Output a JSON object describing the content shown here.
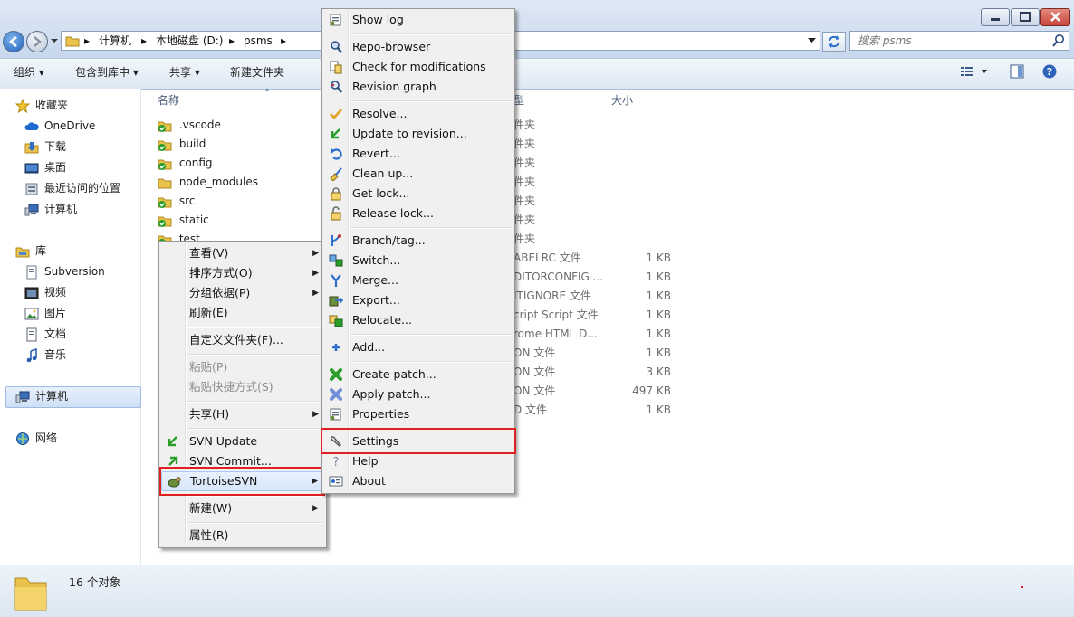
{
  "address": {
    "crumbs": [
      "计算机",
      "本地磁盘 (D:)",
      "psms"
    ]
  },
  "search": {
    "placeholder": "搜索 psms"
  },
  "toolbar": {
    "organize": "组织",
    "include": "包含到库中",
    "share": "共享",
    "new_folder": "新建文件夹"
  },
  "nav": {
    "favorites": "收藏夹",
    "fav_items": [
      "OneDrive",
      "下载",
      "桌面",
      "最近访问的位置",
      "计算机"
    ],
    "libraries": "库",
    "lib_items": [
      "Subversion",
      "视频",
      "图片",
      "文档",
      "音乐"
    ],
    "computer": "计算机",
    "network": "网络"
  },
  "columns": {
    "name": "名称",
    "type": "型",
    "size": "大小"
  },
  "files": [
    {
      "name": ".vscode",
      "type": "件夹",
      "size": ""
    },
    {
      "name": "build",
      "type": "件夹",
      "size": ""
    },
    {
      "name": "config",
      "type": "件夹",
      "size": ""
    },
    {
      "name": "node_modules",
      "type": "件夹",
      "size": ""
    },
    {
      "name": "src",
      "type": "件夹",
      "size": ""
    },
    {
      "name": "static",
      "type": "件夹",
      "size": ""
    },
    {
      "name": "test",
      "type": "件夹",
      "size": ""
    },
    {
      "name": "",
      "type": "ABELRC 文件",
      "size": "1 KB"
    },
    {
      "name": "",
      "type": "DITORCONFIG ...",
      "size": "1 KB"
    },
    {
      "name": "",
      "type": "ITIGNORE 文件",
      "size": "1 KB"
    },
    {
      "name": "",
      "type": "cript Script 文件",
      "size": "1 KB"
    },
    {
      "name": "",
      "type": "rome HTML D...",
      "size": "1 KB"
    },
    {
      "name": "",
      "type": "ON 文件",
      "size": "1 KB"
    },
    {
      "name": "",
      "type": "ON 文件",
      "size": "3 KB"
    },
    {
      "name": "",
      "type": "ON 文件",
      "size": "497 KB"
    },
    {
      "name": "",
      "type": "D 文件",
      "size": "1 KB"
    }
  ],
  "status": {
    "count": "16 个对象"
  },
  "context_menu": {
    "view": "查看(V)",
    "sort": "排序方式(O)",
    "group": "分组依据(P)",
    "refresh": "刷新(E)",
    "customize": "自定义文件夹(F)...",
    "paste": "粘贴(P)",
    "paste_shortcut": "粘贴快捷方式(S)",
    "share": "共享(H)",
    "svn_update": "SVN Update",
    "svn_commit": "SVN Commit...",
    "tortoise": "TortoiseSVN",
    "new": "新建(W)",
    "properties": "属性(R)"
  },
  "svn_menu": {
    "show_log": "Show log",
    "repo_browser": "Repo-browser",
    "check_mod": "Check for modifications",
    "rev_graph": "Revision graph",
    "resolve": "Resolve...",
    "update_rev": "Update to revision...",
    "revert": "Revert...",
    "cleanup": "Clean up...",
    "get_lock": "Get lock...",
    "release_lock": "Release lock...",
    "branch": "Branch/tag...",
    "switch": "Switch...",
    "merge": "Merge...",
    "export": "Export...",
    "relocate": "Relocate...",
    "add": "Add...",
    "create_patch": "Create patch...",
    "apply_patch": "Apply patch...",
    "properties": "Properties",
    "settings": "Settings",
    "help": "Help",
    "about": "About"
  },
  "colors": {
    "highlight_box": "#e02020",
    "svn_green": "#2a9d2a",
    "folder_yellow": "#e8c24a",
    "window_close": "#c8443a"
  }
}
